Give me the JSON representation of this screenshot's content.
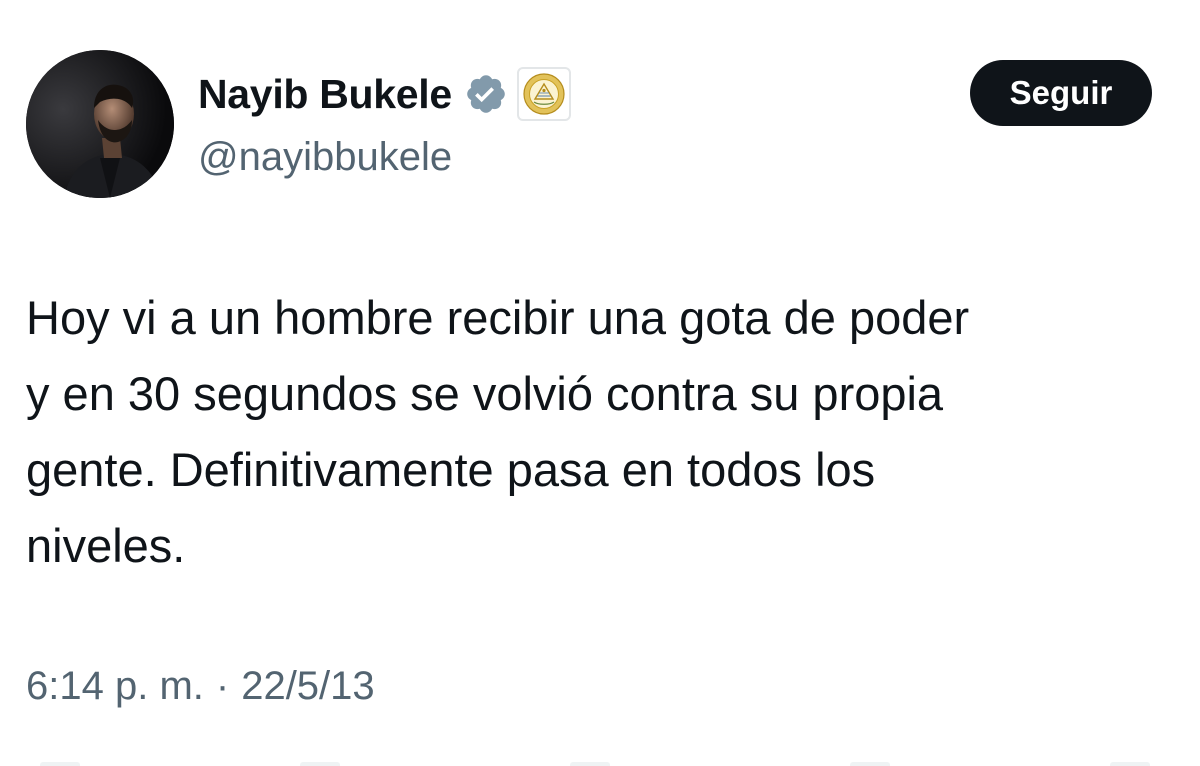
{
  "author": {
    "display_name": "Nayib Bukele",
    "handle": "@nayibbukele",
    "verified_icon": "verified-badge-icon",
    "affiliation_icon": "government-seal-icon",
    "avatar_icon": "profile-photo"
  },
  "follow_button": {
    "label": "Seguir"
  },
  "tweet": {
    "lines": [
      "Hoy vi a un hombre recibir una gota de poder",
      "y en 30 segundos se volvió contra su propia",
      "gente. Definitivamente pasa en todos los",
      "niveles."
    ],
    "time": "6:14 p. m.",
    "separator": "·",
    "date": "22/5/13"
  },
  "colors": {
    "text_primary": "#0f1419",
    "text_secondary": "#536471",
    "verified": "#829aab",
    "seal_gold": "#c9a227",
    "button_bg": "#0f1419",
    "button_text": "#ffffff"
  }
}
